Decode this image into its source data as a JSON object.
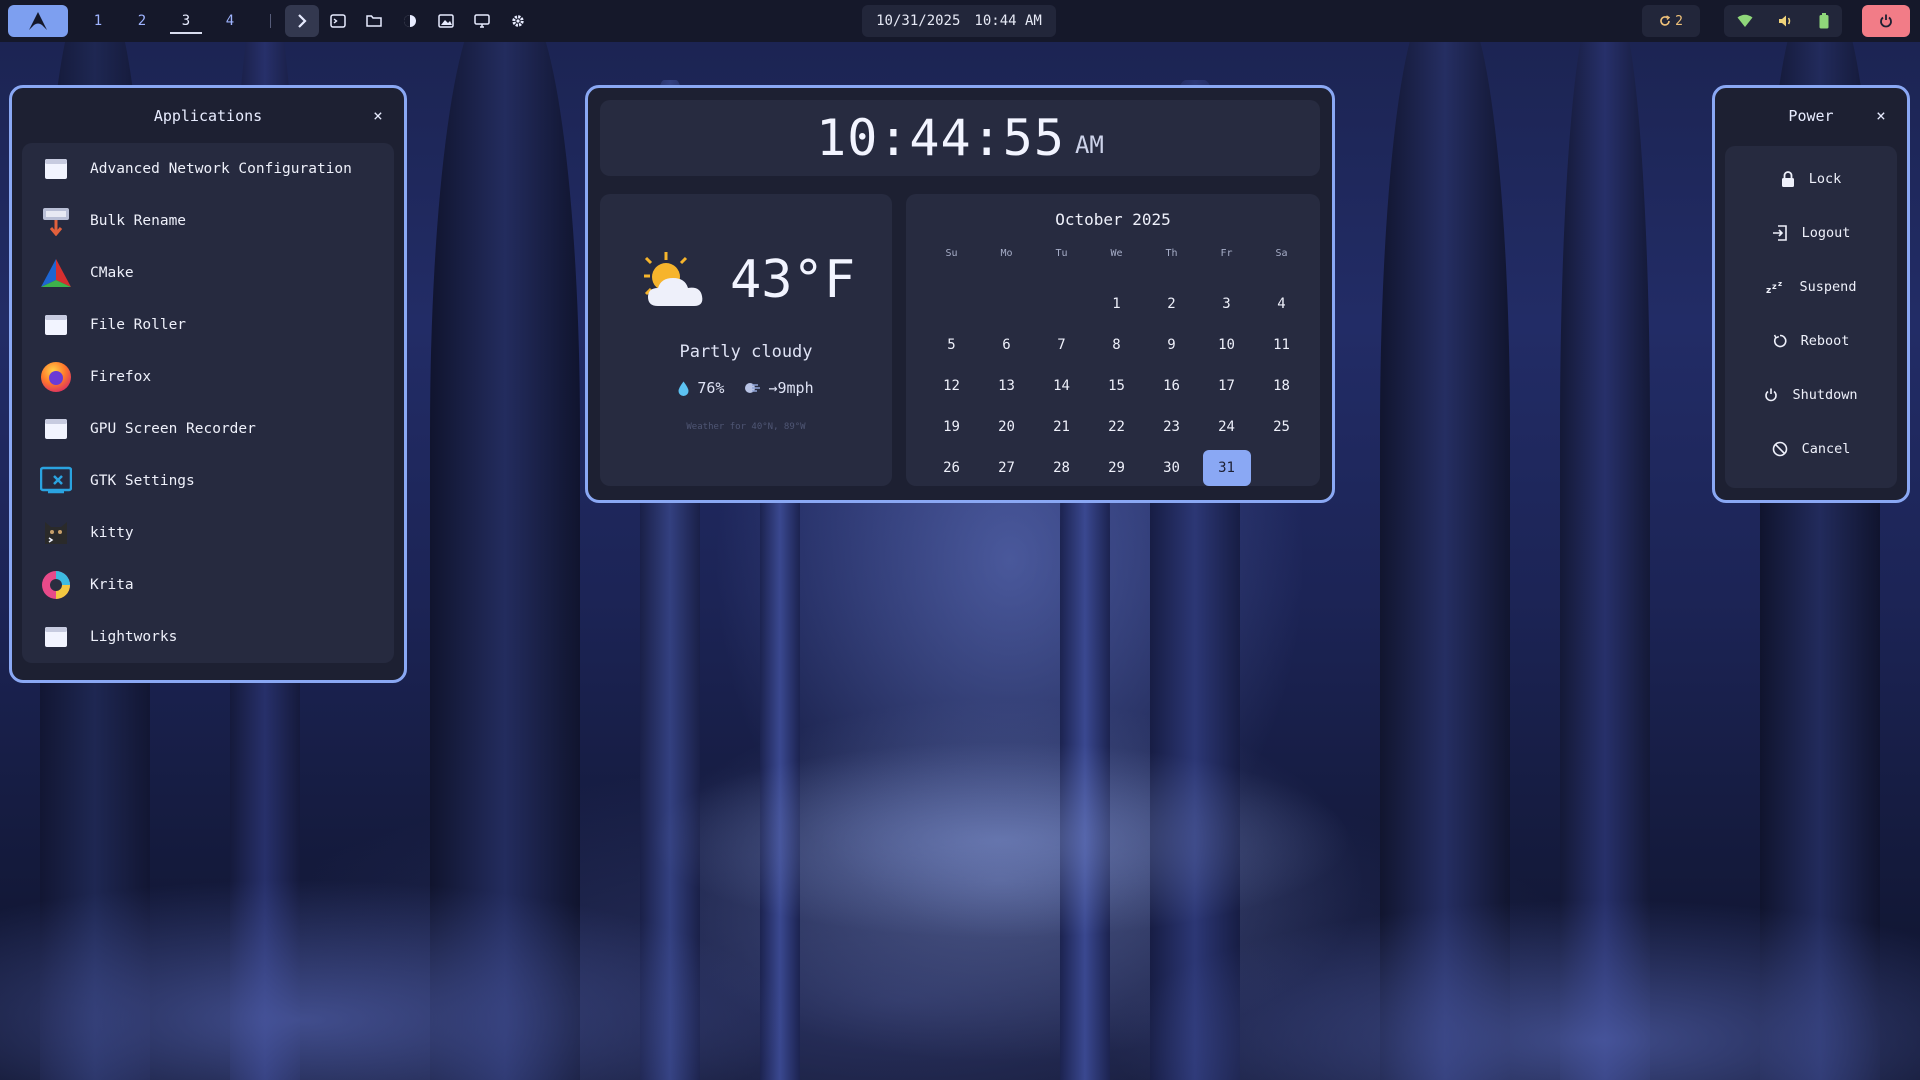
{
  "topbar": {
    "workspaces": [
      "1",
      "2",
      "3",
      "4"
    ],
    "active_workspace": "3",
    "date": "10/31/2025",
    "time": "10:44 AM",
    "updates_count": "2"
  },
  "applications": {
    "title": "Applications",
    "close": "×",
    "items": [
      {
        "label": "Advanced Network Configuration",
        "icon": "window-icon"
      },
      {
        "label": "Bulk Rename",
        "icon": "bulk-rename-icon"
      },
      {
        "label": "CMake",
        "icon": "cmake-icon"
      },
      {
        "label": "File Roller",
        "icon": "window-icon"
      },
      {
        "label": "Firefox",
        "icon": "firefox-icon"
      },
      {
        "label": "GPU Screen Recorder",
        "icon": "window-icon"
      },
      {
        "label": "GTK Settings",
        "icon": "gtk-settings-icon"
      },
      {
        "label": "kitty",
        "icon": "kitty-icon"
      },
      {
        "label": "Krita",
        "icon": "krita-icon"
      },
      {
        "label": "Lightworks",
        "icon": "window-icon"
      }
    ]
  },
  "clock": {
    "time": "10:44:55",
    "ampm": "AM"
  },
  "weather": {
    "temp": "43°F",
    "condition": "Partly cloudy",
    "humidity": "76%",
    "wind": "→9mph",
    "location": "Weather for 40°N, 89°W"
  },
  "calendar": {
    "title": "October 2025",
    "weekdays": [
      "Su",
      "Mo",
      "Tu",
      "We",
      "Th",
      "Fr",
      "Sa"
    ],
    "days": [
      "",
      "",
      "",
      "1",
      "2",
      "3",
      "4",
      "5",
      "6",
      "7",
      "8",
      "9",
      "10",
      "11",
      "12",
      "13",
      "14",
      "15",
      "16",
      "17",
      "18",
      "19",
      "20",
      "21",
      "22",
      "23",
      "24",
      "25",
      "26",
      "27",
      "28",
      "29",
      "30",
      "31",
      ""
    ],
    "today": "31"
  },
  "power": {
    "title": "Power",
    "close": "×",
    "items": [
      {
        "label": "Lock",
        "icon": "lock-icon"
      },
      {
        "label": "Logout",
        "icon": "logout-icon"
      },
      {
        "label": "Suspend",
        "icon": "suspend-icon"
      },
      {
        "label": "Reboot",
        "icon": "reboot-icon"
      },
      {
        "label": "Shutdown",
        "icon": "shutdown-icon"
      },
      {
        "label": "Cancel",
        "icon": "cancel-icon"
      }
    ]
  },
  "colors": {
    "accent": "#8aa8f4",
    "panel_bg": "#1d2032",
    "power_button": "#f27c87",
    "updates": "#f0c27a"
  }
}
